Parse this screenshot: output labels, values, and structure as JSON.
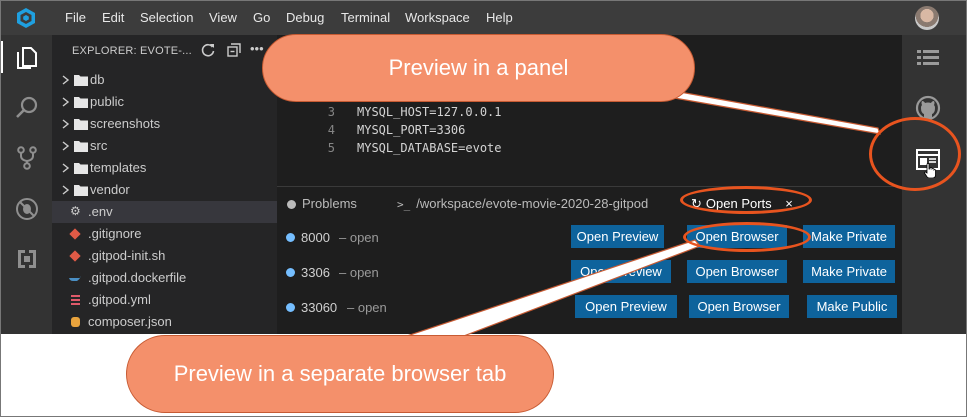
{
  "menubar": {
    "items": [
      "File",
      "Edit",
      "Selection",
      "View",
      "Go",
      "Debug",
      "Terminal",
      "Workspace",
      "Help"
    ]
  },
  "sidebar": {
    "title": "EXPLORER: EVOTE-...",
    "items": [
      {
        "label": "db",
        "type": "folder"
      },
      {
        "label": "public",
        "type": "folder"
      },
      {
        "label": "screenshots",
        "type": "folder"
      },
      {
        "label": "src",
        "type": "folder"
      },
      {
        "label": "templates",
        "type": "folder"
      },
      {
        "label": "vendor",
        "type": "folder"
      },
      {
        "label": ".env",
        "type": "file",
        "icon": "gear-icon",
        "selected": true
      },
      {
        "label": ".gitignore",
        "type": "file",
        "icon": "git-icon"
      },
      {
        "label": ".gitpod-init.sh",
        "type": "file",
        "icon": "shell-icon"
      },
      {
        "label": ".gitpod.dockerfile",
        "type": "file",
        "icon": "docker-icon"
      },
      {
        "label": ".gitpod.yml",
        "type": "file",
        "icon": "yaml-icon"
      },
      {
        "label": "composer.json",
        "type": "file",
        "icon": "json-icon"
      }
    ]
  },
  "editor": {
    "lines": [
      {
        "num": "3",
        "text": "MYSQL_HOST=127.0.0.1"
      },
      {
        "num": "4",
        "text": "MYSQL_PORT=3306"
      },
      {
        "num": "5",
        "text": "MYSQL_DATABASE=evote"
      }
    ]
  },
  "panel": {
    "tabs": {
      "problems": "Problems",
      "terminal": "/workspace/evote-movie-2020-28-gitpod",
      "ports": "Open Ports",
      "close": "×"
    },
    "ports": [
      {
        "port": "8000",
        "status": "– open",
        "actions": [
          "Open Preview",
          "Open Browser",
          "Make Private"
        ]
      },
      {
        "port": "3306",
        "status": "– open",
        "actions": [
          "Open Preview",
          "Open Browser",
          "Make Private"
        ]
      },
      {
        "port": "33060",
        "status": "– open",
        "actions": [
          "Open Preview",
          "Open Browser",
          "Make Public"
        ]
      }
    ]
  },
  "callouts": {
    "panel": "Preview in a panel",
    "browser": "Preview in a separate browser tab"
  },
  "colors": {
    "accent_button": "#0e639c",
    "callout_fill": "#f4906b",
    "callout_ring": "#e8541f",
    "port_dot": "#75beff"
  }
}
